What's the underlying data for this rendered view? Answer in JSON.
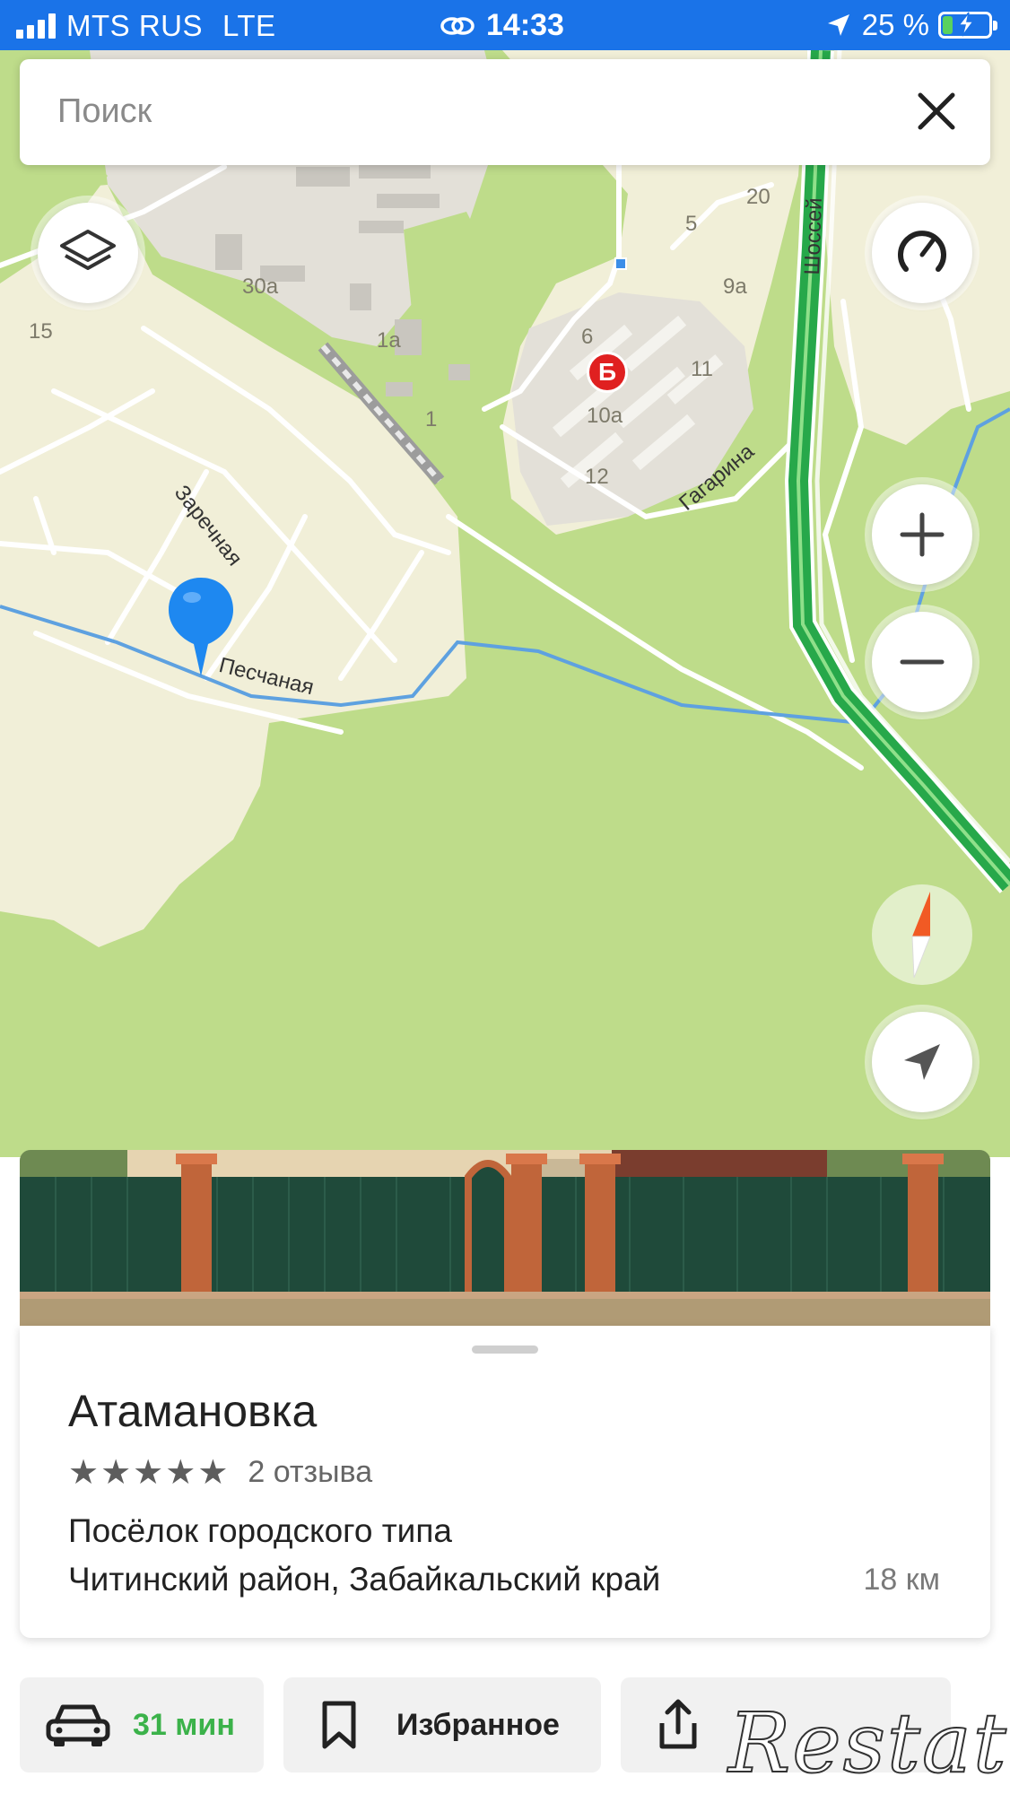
{
  "status_bar": {
    "carrier": "MTS RUS",
    "network": "LTE",
    "time": "14:33",
    "battery": "25 %",
    "battery_level": 0.25,
    "icons": [
      "signal-icon",
      "link-icon",
      "location-arrow-icon",
      "battery-charging-icon"
    ]
  },
  "search": {
    "placeholder": "Поиск",
    "value": ""
  },
  "map": {
    "streets": [
      "Заречная",
      "Песчаная",
      "Гагарина",
      "Шоссей"
    ],
    "house_numbers": [
      "30а",
      "15",
      "1а",
      "1",
      "5",
      "20",
      "9а",
      "6",
      "11",
      "10а",
      "12"
    ],
    "poi_letter": "Б",
    "colors": {
      "land": "#bedc8a",
      "built": "#f1efd8",
      "industrial": "#e3e0d8",
      "water": "#5ea1e0",
      "route": "#27a84a",
      "pin": "#1e88f0",
      "poi": "#e02020"
    }
  },
  "place": {
    "title": "Атамановка",
    "stars": 5,
    "reviews": "2 отзыва",
    "type": "Посёлок городского типа",
    "region": "Читинский район, Забайкальский край",
    "distance": "18 км"
  },
  "actions": {
    "route": "31 мин",
    "favorite": "Избранное"
  },
  "watermark": "Restate"
}
